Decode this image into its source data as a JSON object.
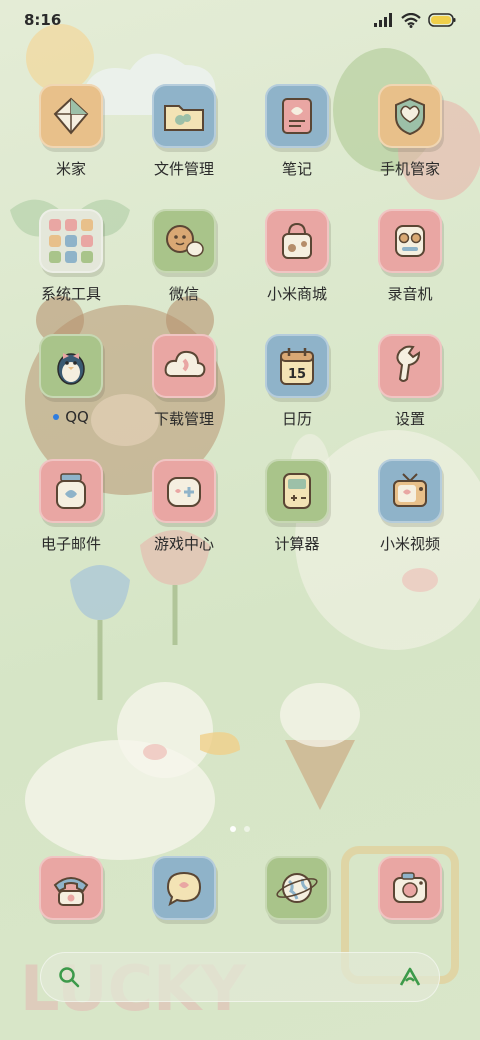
{
  "status_bar": {
    "time": "8:16"
  },
  "apps": [
    {
      "label": "米家",
      "icon": "kite-icon",
      "bg": "#e8c08a"
    },
    {
      "label": "文件管理",
      "icon": "folder-icon",
      "bg": "#8fb3c9"
    },
    {
      "label": "笔记",
      "icon": "notebook-icon",
      "bg": "#8fb3c9"
    },
    {
      "label": "手机管家",
      "icon": "shield-icon",
      "bg": "#e8c08a"
    },
    {
      "label": "系统工具",
      "icon": "folder-grid-icon",
      "bg": "#e4e7da"
    },
    {
      "label": "微信",
      "icon": "chat-cookie-icon",
      "bg": "#a9c48a"
    },
    {
      "label": "小米商城",
      "icon": "shopping-bag-icon",
      "bg": "#e9a6a3"
    },
    {
      "label": "录音机",
      "icon": "recorder-icon",
      "bg": "#e9a6a3"
    },
    {
      "label": "QQ",
      "icon": "penguin-icon",
      "bg": "#a9c48a",
      "badge": true
    },
    {
      "label": "下载管理",
      "icon": "cloud-download-icon",
      "bg": "#e9a6a3"
    },
    {
      "label": "日历",
      "icon": "calendar-icon",
      "bg": "#8fb3c9",
      "day": "15"
    },
    {
      "label": "设置",
      "icon": "wrench-icon",
      "bg": "#e9a6a3"
    },
    {
      "label": "电子邮件",
      "icon": "mail-jar-icon",
      "bg": "#e9a6a3"
    },
    {
      "label": "游戏中心",
      "icon": "gamepad-icon",
      "bg": "#e9a6a3"
    },
    {
      "label": "计算器",
      "icon": "calculator-icon",
      "bg": "#a9c48a"
    },
    {
      "label": "小米视频",
      "icon": "tv-icon",
      "bg": "#8fb3c9"
    }
  ],
  "dock": [
    {
      "icon": "phone-icon",
      "bg": "#e9a6a3"
    },
    {
      "icon": "message-icon",
      "bg": "#8fb3c9"
    },
    {
      "icon": "browser-globe-icon",
      "bg": "#a9c48a"
    },
    {
      "icon": "camera-icon",
      "bg": "#e9a6a3"
    }
  ],
  "wallpaper_text": "LUCKY"
}
